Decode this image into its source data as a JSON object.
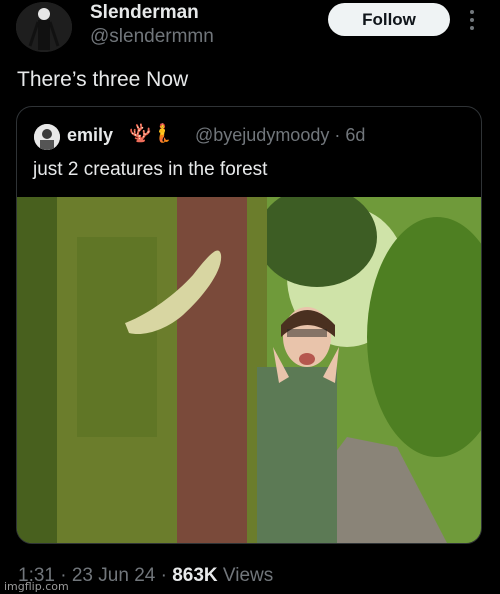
{
  "author": {
    "name": "Slenderman",
    "handle": "@slendermmn",
    "follow_label": "Follow"
  },
  "tweet": {
    "text": "There’s three Now"
  },
  "quoted_tweet": {
    "name": "emily",
    "emojis": "🪸🧜",
    "handle_time": "@byejudymoody · 6d",
    "text": "just 2 creatures in the forest"
  },
  "meta": {
    "time_date": "1:31 · 23 Jun 24 · ",
    "views_count": "863K",
    "views_label": " Views"
  },
  "watermark": "imgflip.com",
  "icons": {
    "more": "more-vertical-icon"
  },
  "colors": {
    "background": "#000000",
    "secondary_text": "#71767b",
    "follow_bg": "#eff3f4"
  }
}
